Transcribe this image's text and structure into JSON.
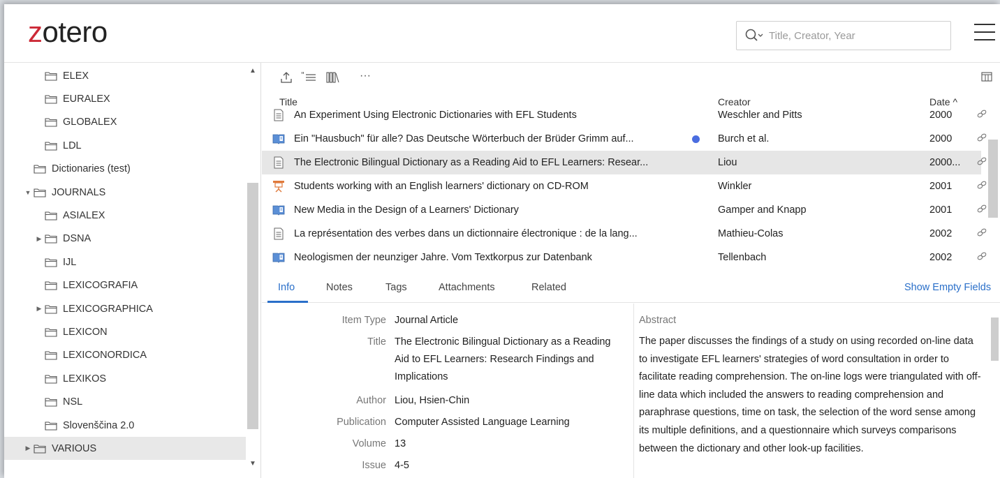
{
  "app": {
    "logo_prefix": "z",
    "logo_rest": "otero"
  },
  "search": {
    "placeholder": "Title, Creator, Year"
  },
  "collections": [
    {
      "label": "ELEX",
      "indent": 2,
      "twisty": ""
    },
    {
      "label": "EURALEX",
      "indent": 2,
      "twisty": ""
    },
    {
      "label": "GLOBALEX",
      "indent": 2,
      "twisty": ""
    },
    {
      "label": "LDL",
      "indent": 2,
      "twisty": ""
    },
    {
      "label": "Dictionaries (test)",
      "indent": 1,
      "twisty": ""
    },
    {
      "label": "JOURNALS",
      "indent": 1,
      "twisty": "▼"
    },
    {
      "label": "ASIALEX",
      "indent": 2,
      "twisty": ""
    },
    {
      "label": "DSNA",
      "indent": 2,
      "twisty": "▶"
    },
    {
      "label": "IJL",
      "indent": 2,
      "twisty": ""
    },
    {
      "label": "LEXICOGRAFIA",
      "indent": 2,
      "twisty": ""
    },
    {
      "label": "LEXICOGRAPHICA",
      "indent": 2,
      "twisty": "▶"
    },
    {
      "label": "LEXICON",
      "indent": 2,
      "twisty": ""
    },
    {
      "label": "LEXICONORDICA",
      "indent": 2,
      "twisty": ""
    },
    {
      "label": "LEXIKOS",
      "indent": 2,
      "twisty": ""
    },
    {
      "label": "NSL",
      "indent": 2,
      "twisty": ""
    },
    {
      "label": "Slovenščina 2.0",
      "indent": 2,
      "twisty": ""
    },
    {
      "label": "VARIOUS",
      "indent": 1,
      "twisty": "▶",
      "selected": true
    }
  ],
  "toolbar": {
    "more": "···"
  },
  "columns": {
    "title": "Title",
    "creator": "Creator",
    "date": "Date ^"
  },
  "items": [
    {
      "type": "document",
      "title": "An Experiment Using Electronic Dictionaries with EFL Students",
      "creator": "Weschler and Pitts",
      "date": "2000"
    },
    {
      "type": "book",
      "title": "Ein \"Hausbuch\" für alle? Das Deutsche Wörterbuch der Brüder Grimm auf...",
      "creator": "Burch et al.",
      "date": "2000",
      "unread": true
    },
    {
      "type": "document",
      "title": "The Electronic Bilingual Dictionary as a Reading Aid to EFL Learners: Resear...",
      "creator": "Liou",
      "date": "2000...",
      "selected": true
    },
    {
      "type": "presentation",
      "title": "Students working with an English learners' dictionary on CD-ROM",
      "creator": "Winkler",
      "date": "2001"
    },
    {
      "type": "book",
      "title": "New Media in the Design of a Learners' Dictionary",
      "creator": "Gamper and Knapp",
      "date": "2001"
    },
    {
      "type": "document",
      "title": "La représentation des verbes dans un dictionnaire électronique : de la lang...",
      "creator": "Mathieu-Colas",
      "date": "2002"
    },
    {
      "type": "book",
      "title": "Neologismen der neunziger Jahre. Vom Textkorpus zur Datenbank",
      "creator": "Tellenbach",
      "date": "2002"
    }
  ],
  "tabs": {
    "info": "Info",
    "notes": "Notes",
    "tags": "Tags",
    "attachments": "Attachments",
    "related": "Related",
    "show_empty": "Show Empty Fields"
  },
  "info": {
    "item_type_label": "Item Type",
    "item_type": "Journal Article",
    "title_label": "Title",
    "title": "The Electronic Bilingual Dictionary as a Reading Aid to EFL Learners: Research Findings and Implications",
    "author_label": "Author",
    "author": "Liou, Hsien-Chin",
    "publication_label": "Publication",
    "publication": "Computer Assisted Language Learning",
    "volume_label": "Volume",
    "volume": "13",
    "issue_label": "Issue",
    "issue": "4-5"
  },
  "abstract": {
    "label": "Abstract",
    "text": "The paper discusses the findings of a study on using recorded on-line data to investigate EFL learners' strategies of word consultation in order to facilitate reading comprehension. The on-line logs were triangulated with off-line data which included the answers to reading comprehension and paraphrase questions, time on task, the selection of the word sense among its multiple definitions, and a questionnaire which surveys comparisons between the dictionary and other look-up facilities."
  },
  "colors": {
    "accent": "#2a6fc9",
    "logo_red": "#cc2936",
    "unread_dot": "#4a6de0"
  }
}
